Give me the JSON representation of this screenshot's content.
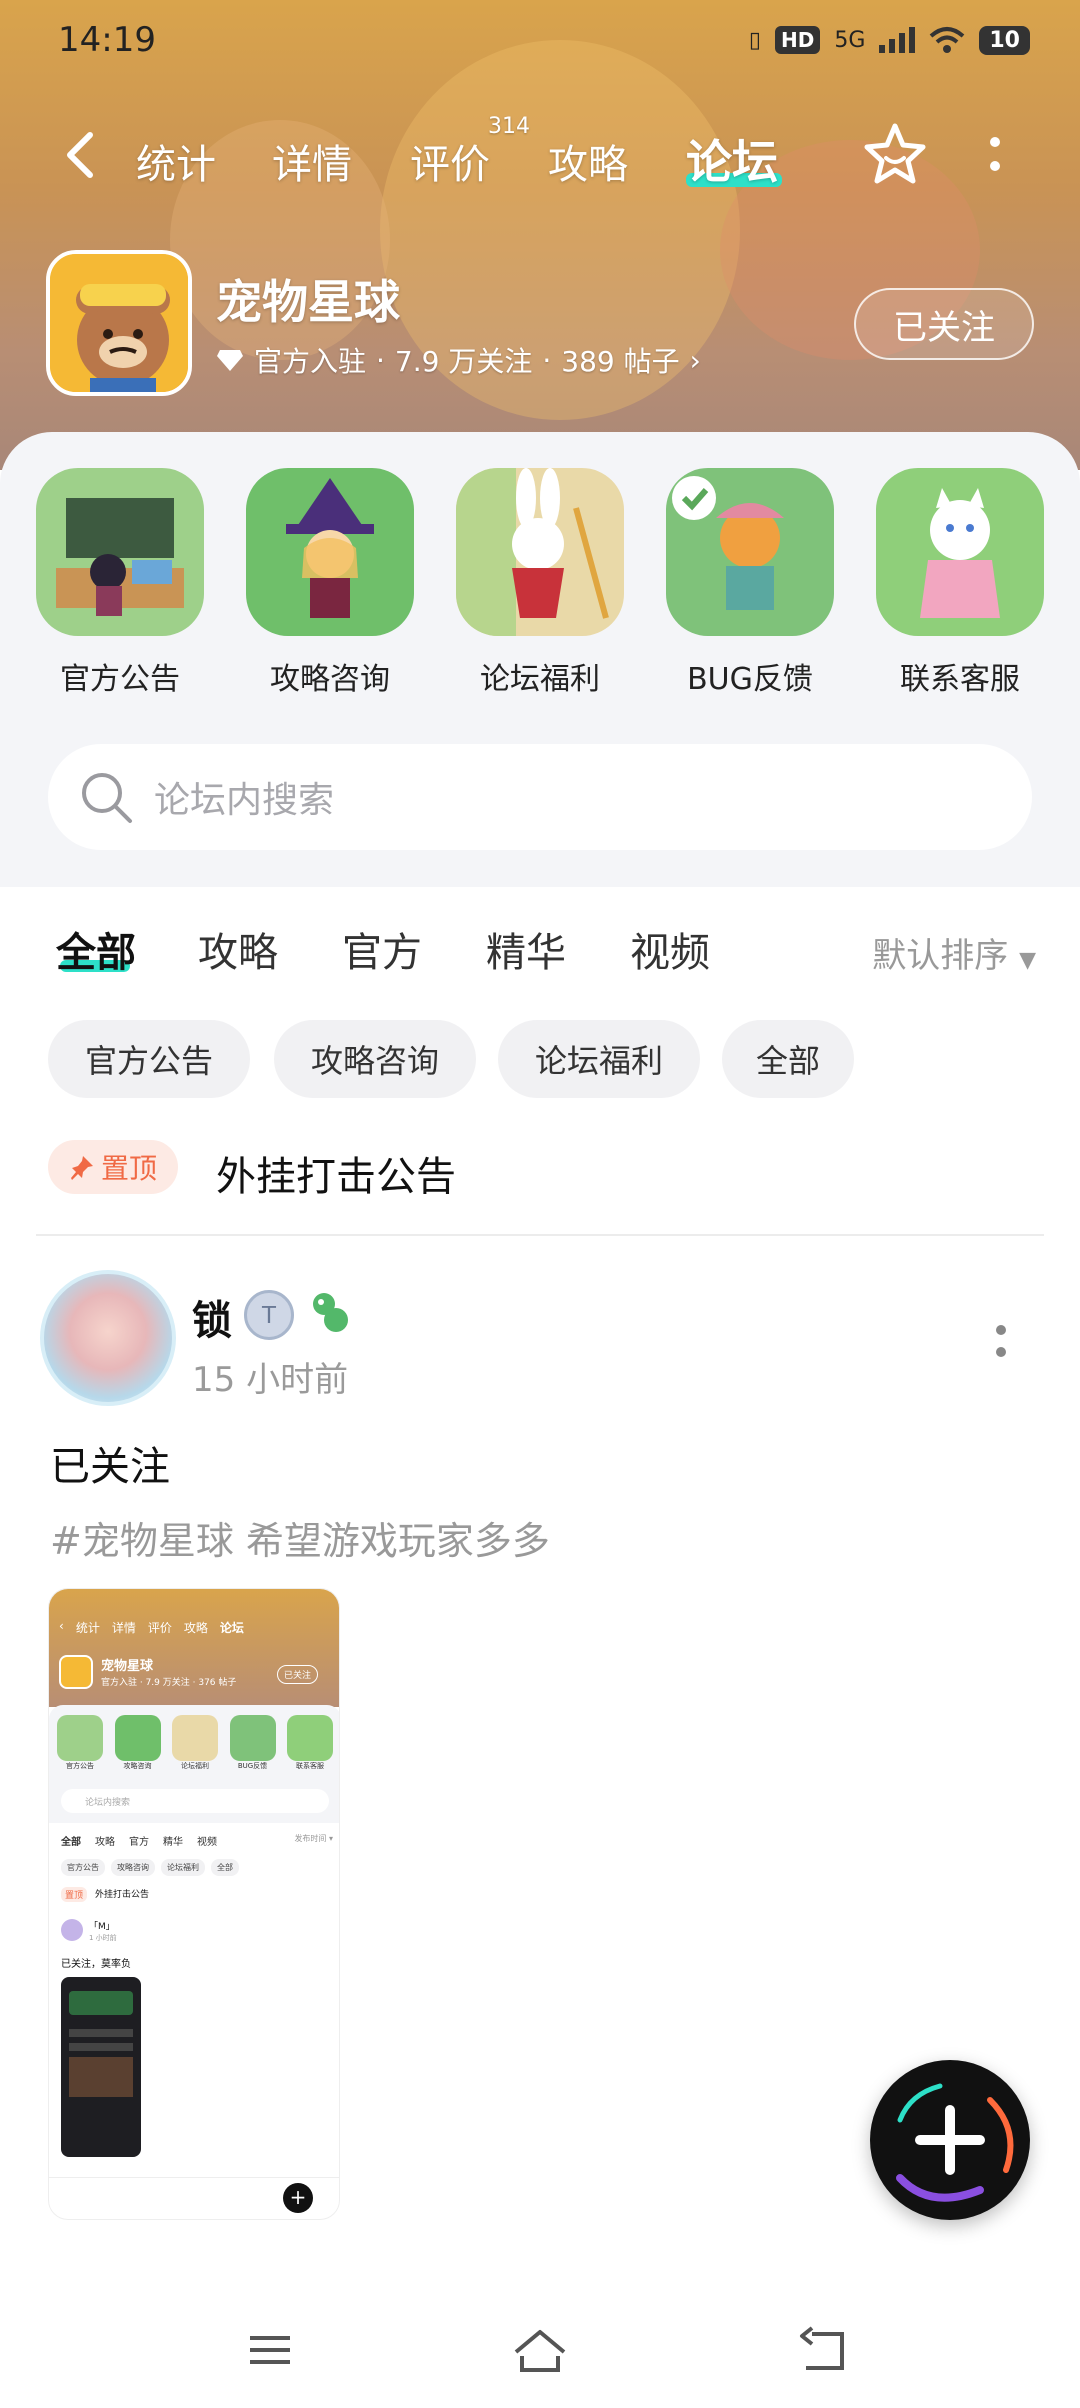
{
  "status_bar": {
    "time": "14:19",
    "network": "5G",
    "hd": "HD",
    "battery": "10"
  },
  "nav": {
    "tabs": [
      {
        "label": "统计"
      },
      {
        "label": "详情"
      },
      {
        "label": "评价",
        "badge": "314"
      },
      {
        "label": "攻略"
      },
      {
        "label": "论坛",
        "active": true
      }
    ]
  },
  "game": {
    "title": "宠物星球",
    "official": "官方入驻",
    "followers": "7.9 万关注",
    "posts": "389 帖子",
    "sep": "·",
    "follow_label": "已关注"
  },
  "quick_entries": [
    {
      "label": "官方公告"
    },
    {
      "label": "攻略咨询"
    },
    {
      "label": "论坛福利"
    },
    {
      "label": "BUG反馈"
    },
    {
      "label": "联系客服"
    }
  ],
  "search": {
    "placeholder": "论坛内搜索"
  },
  "feed_tabs": [
    {
      "label": "全部",
      "active": true
    },
    {
      "label": "攻略"
    },
    {
      "label": "官方"
    },
    {
      "label": "精华"
    },
    {
      "label": "视频"
    }
  ],
  "sort_label": "默认排序",
  "chips": [
    {
      "label": "官方公告"
    },
    {
      "label": "攻略咨询"
    },
    {
      "label": "论坛福利"
    },
    {
      "label": "全部"
    }
  ],
  "pinned": {
    "badge": "置顶",
    "title": "外挂打击公告"
  },
  "post": {
    "author": "锁",
    "time": "15 小时前",
    "title": "已关注",
    "tags": "#宠物星球 希望游戏玩家多多"
  },
  "mini": {
    "tabs": [
      "统计",
      "详情",
      "评价",
      "攻略",
      "论坛"
    ],
    "title": "宠物星球",
    "meta": "官方入驻 · 7.9 万关注 · 376 帖子",
    "follow": "已关注",
    "icons": [
      "官方公告",
      "攻略咨询",
      "论坛福利",
      "BUG反馈",
      "联系客服"
    ],
    "search": "论坛内搜索",
    "ftabs": [
      "全部",
      "攻略",
      "官方",
      "精华",
      "视频"
    ],
    "sort": "发布时间 ▾",
    "chips": [
      "官方公告",
      "攻略咨询",
      "论坛福利",
      "全部"
    ],
    "pin": "置顶",
    "pin_title": "外挂打击公告",
    "author": "「M」",
    "time": "1 小时前",
    "post_title": "已关注，莫率负"
  },
  "colors": {
    "accent": "#2de0c8",
    "pin": "#f06a45"
  }
}
